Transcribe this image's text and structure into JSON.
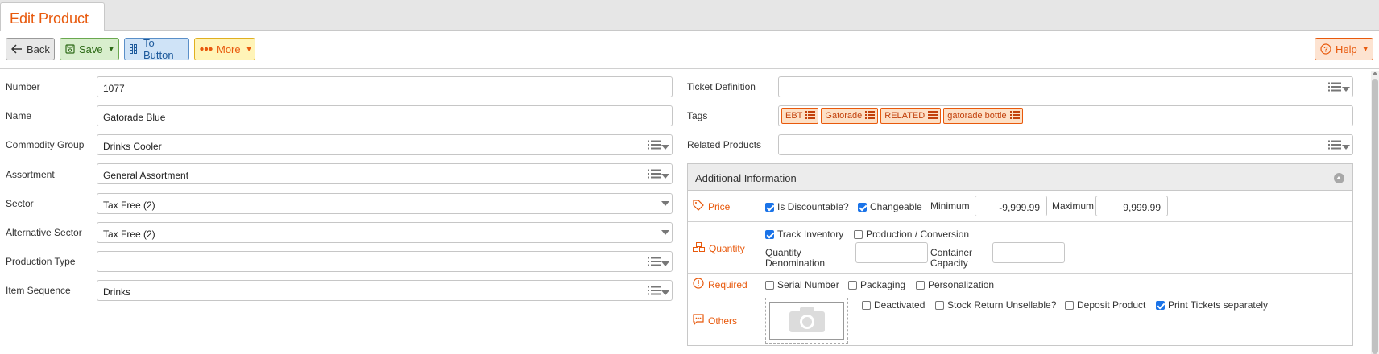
{
  "tab": {
    "title": "Edit Product"
  },
  "toolbar": {
    "back_label": "Back",
    "save_label": "Save",
    "to_button_label": "To Button",
    "more_label": "More",
    "help_label": "Help"
  },
  "fields_left": [
    {
      "label": "Number",
      "value": "1077"
    },
    {
      "label": "Name",
      "value": "Gatorade Blue"
    },
    {
      "label": "Commodity Group",
      "value": "Drinks Cooler"
    },
    {
      "label": "Assortment",
      "value": "General Assortment"
    },
    {
      "label": "Sector",
      "value": "Tax Free (2)"
    },
    {
      "label": "Alternative Sector",
      "value": "Tax Free (2)"
    },
    {
      "label": "Production Type",
      "value": ""
    },
    {
      "label": "Item Sequence",
      "value": "Drinks"
    }
  ],
  "fields_right": {
    "ticket_definition": {
      "label": "Ticket Definition",
      "value": ""
    },
    "tags": {
      "label": "Tags",
      "items": [
        "EBT",
        "Gatorade",
        "RELATED",
        "gatorade bottle"
      ]
    },
    "related_products": {
      "label": "Related Products",
      "value": ""
    }
  },
  "additional": {
    "title": "Additional Information",
    "price": {
      "label": "Price",
      "is_discountable": {
        "label": "Is Discountable?",
        "checked": true
      },
      "changeable": {
        "label": "Changeable",
        "checked": true
      },
      "minimum_label": "Minimum",
      "minimum_value": "-9,999.99",
      "maximum_label": "Maximum",
      "maximum_value": "9,999.99"
    },
    "quantity": {
      "label": "Quantity",
      "track_inventory": {
        "label": "Track Inventory",
        "checked": true
      },
      "production_conversion": {
        "label": "Production / Conversion",
        "checked": false
      },
      "quantity_denomination_label_1": "Quantity",
      "quantity_denomination_label_2": "Denomination",
      "quantity_denomination_value": "",
      "container_capacity_label_1": "Container",
      "container_capacity_label_2": "Capacity",
      "container_capacity_value": ""
    },
    "required": {
      "label": "Required",
      "serial_number": {
        "label": "Serial Number",
        "checked": false
      },
      "packaging": {
        "label": "Packaging",
        "checked": false
      },
      "personalization": {
        "label": "Personalization",
        "checked": false
      }
    },
    "others": {
      "label": "Others",
      "deactivated": {
        "label": "Deactivated",
        "checked": false
      },
      "stock_return_unsellable": {
        "label": "Stock Return Unsellable?",
        "checked": false
      },
      "deposit_product": {
        "label": "Deposit Product",
        "checked": false
      },
      "print_tickets_separately": {
        "label": "Print Tickets separately",
        "checked": true
      }
    }
  },
  "colors": {
    "accent": "#e8590c",
    "checkbox": "#1a73e8",
    "save": "#6aa84f",
    "to_button": "#5a8fc8",
    "more": "#e0b020"
  }
}
